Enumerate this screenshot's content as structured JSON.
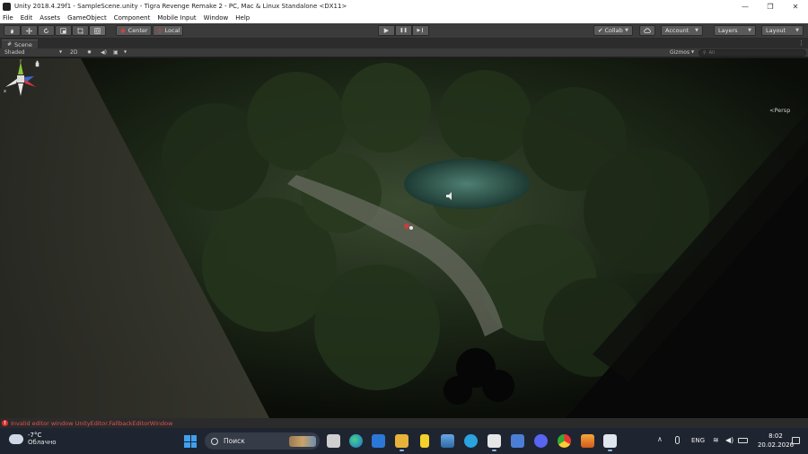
{
  "window": {
    "title": "Unity 2018.4.29f1 - SampleScene.unity - Tigra Revenge Remake 2 - PC, Mac & Linux Standalone <DX11>",
    "controls": [
      "—",
      "❐",
      "✕"
    ]
  },
  "menu": [
    "File",
    "Edit",
    "Assets",
    "GameObject",
    "Component",
    "Mobile Input",
    "Window",
    "Help"
  ],
  "toolbar": {
    "pivot_label": "Center",
    "space_label": "Local",
    "collab_label": "Collab",
    "account_label": "Account",
    "layers_label": "Layers",
    "layout_label": "Layout",
    "play_icon": "▶",
    "pause_icon": "❚❚",
    "step_icon": "▶❙"
  },
  "scene": {
    "tab_label": "Scene",
    "shading_mode": "Shaded",
    "mode_2d": "2D",
    "gizmos_label": "Gizmos",
    "search_placeholder": "All",
    "persp_label": "<Persp",
    "gizmo_axis_x": "x",
    "gizmo_axis_y": "y"
  },
  "status": {
    "error_text": "Invalid editor window UnityEditor.FallbackEditorWindow"
  },
  "taskbar": {
    "weather_temp": "-7°C",
    "weather_condition": "Облачно",
    "search_label": "Поиск",
    "language": "ENG",
    "time": "8:02",
    "date": "20.02.2026"
  },
  "colors": {
    "toolbar_bg": "#3b3b3b",
    "error_red": "#e05050",
    "taskbar_bg": "#1f2530"
  }
}
